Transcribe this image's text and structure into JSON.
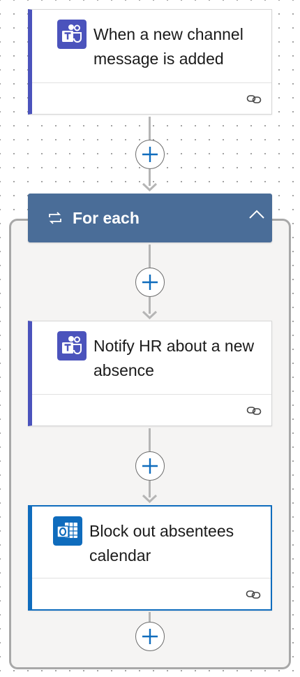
{
  "trigger_card": {
    "icon": "teams-icon",
    "title": "When a new channel message is added",
    "link_icon": "link-icon"
  },
  "foreach": {
    "icon": "loop-icon",
    "title": "For each",
    "collapse_icon": "chevron-up-icon"
  },
  "notify_card": {
    "icon": "teams-icon",
    "title": "Notify HR about a new absence",
    "link_icon": "link-icon"
  },
  "block_card": {
    "icon": "outlook-icon",
    "title": "Block out absentees calendar",
    "link_icon": "link-icon"
  },
  "add_step_icon": "plus-icon",
  "colors": {
    "teams_accent": "#4b53bc",
    "foreach_header": "#4a6d98",
    "selected_border": "#0f6cbd",
    "outlook_blue": "#0f6cbd",
    "plus_color": "#0f6cbd"
  }
}
